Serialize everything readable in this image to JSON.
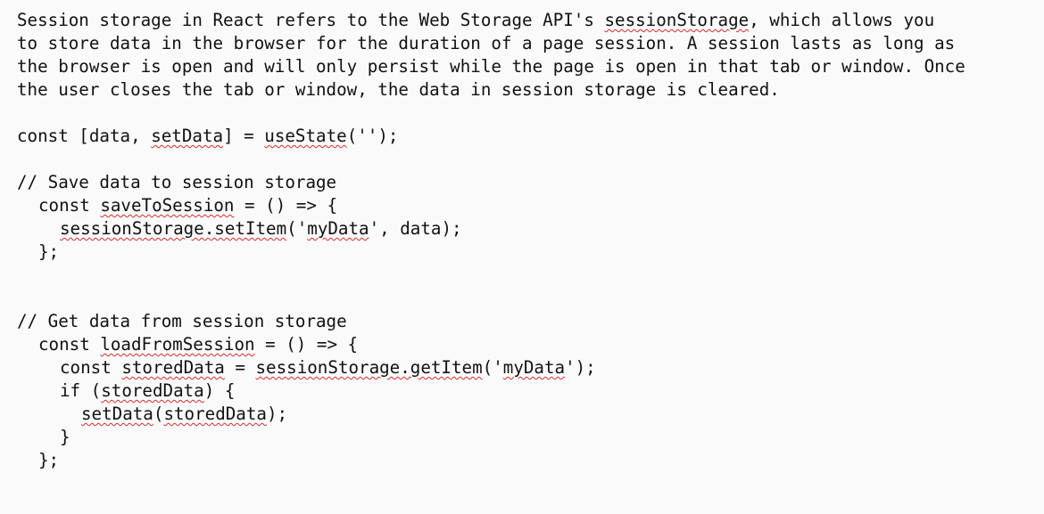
{
  "paragraph": {
    "line1": [
      "Session storage in React refers to the Web Storage API's ",
      "sessionStorage",
      ", which allows you"
    ],
    "line2": "to store data in the browser for the duration of a page session. A session lasts as long as",
    "line3": "the browser is open and will only persist while the page is open in that tab or window. Once",
    "line4": "the user closes the tab or window, the data in session storage is cleared."
  },
  "code": {
    "state_line": [
      "const [data, ",
      "setData",
      "] = ",
      "useState",
      "('');"
    ],
    "comment_save": "// Save data to session storage",
    "save_fn_line": [
      "const ",
      "saveToSession",
      " = () => {"
    ],
    "save_body_line": [
      "sessionStorage.setItem",
      "('",
      "myData",
      "', data);"
    ],
    "save_close": "};",
    "comment_get": "// Get data from session storage",
    "load_fn_line": [
      "const ",
      "loadFromSession",
      " = () => {"
    ],
    "get_item_line": [
      "const ",
      "storedData",
      " = ",
      "sessionStorage.getItem",
      "('",
      "myData",
      "');"
    ],
    "if_line": [
      "if (",
      "storedData",
      ") {"
    ],
    "set_line": [
      "setData",
      "(",
      "storedData",
      ");"
    ],
    "if_close": "}",
    "load_close": "};"
  }
}
